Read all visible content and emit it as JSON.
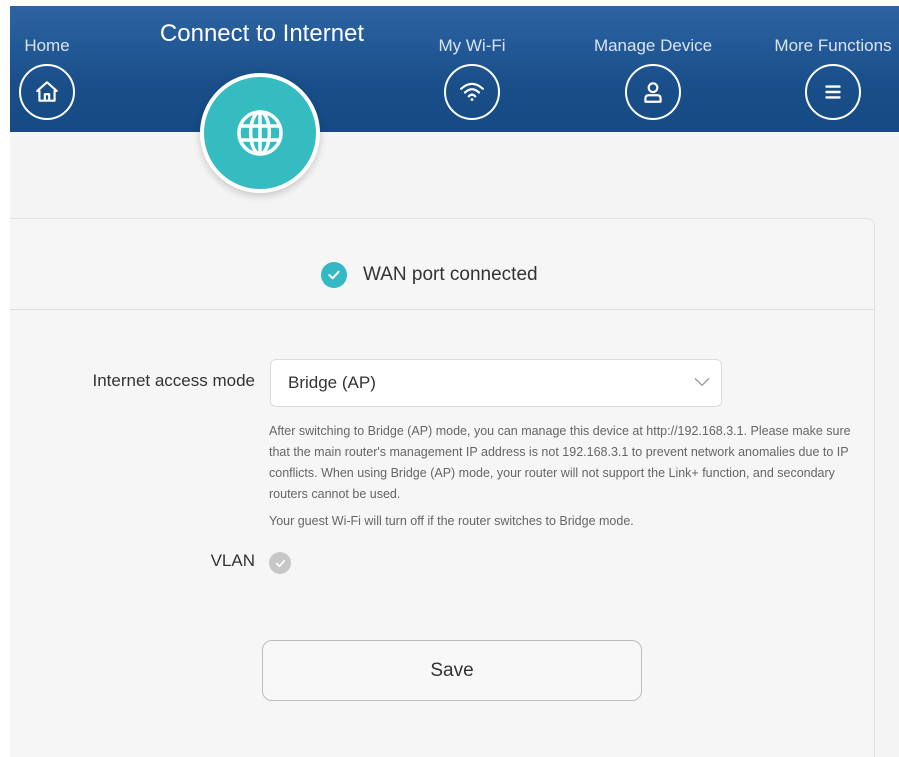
{
  "nav": {
    "home": "Home",
    "connect": "Connect to Internet",
    "wifi": "My Wi-Fi",
    "manage": "Manage Device",
    "more": "More Functions",
    "icons": {
      "home": "home-icon",
      "connect": "globe-icon",
      "wifi": "wifi-icon",
      "manage": "user-icon",
      "more": "menu-icon"
    }
  },
  "status": {
    "text": "WAN port connected",
    "state": "connected"
  },
  "form": {
    "access_mode_label": "Internet access mode",
    "access_mode_value": "Bridge (AP)",
    "help_p1": "After switching to Bridge (AP) mode, you can manage this device at http://192.168.3.1. Please make sure that the main router's management IP address is not 192.168.3.1 to prevent network anomalies due to IP conflicts. When using Bridge (AP) mode, your router will not support the Link+ function, and secondary routers cannot be used.",
    "help_p2": "Your guest Wi-Fi will turn off if the router switches to Bridge mode.",
    "vlan_label": "VLAN",
    "vlan_state": "unchecked",
    "save_label": "Save"
  },
  "colors": {
    "header": "#1a4f8a",
    "accent": "#35bcc0",
    "check": "#33b8c4"
  }
}
